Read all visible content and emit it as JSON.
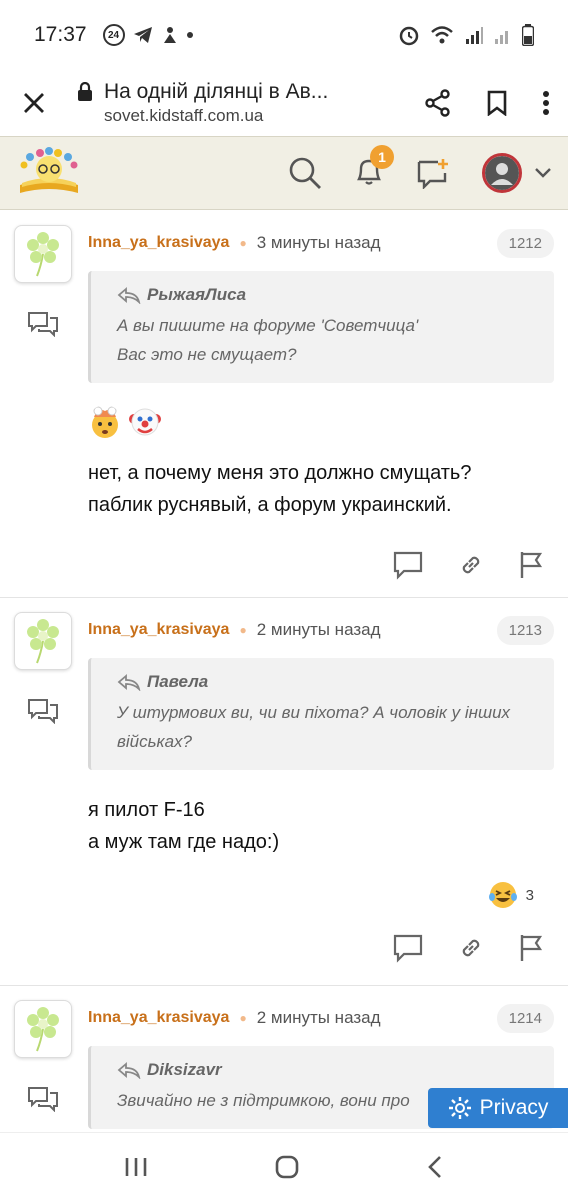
{
  "status_bar": {
    "time": "17:37",
    "badge": "24"
  },
  "browser": {
    "title": "На одній ділянці в Ав...",
    "url": "sovet.kidstaff.com.ua"
  },
  "header": {
    "notification_count": "1"
  },
  "posts": [
    {
      "user": "Inna_ya_krasivaya",
      "time": "3 минуты назад",
      "number": "1212",
      "quote_author": "РыжаяЛиса",
      "quote_lines": [
        "А вы пишите на форуме 'Советчица'",
        "Вас это не смущает?"
      ],
      "text_lines": [
        "нет, а почему меня это должно смущать?",
        "паблик руснявый, а форум украинский."
      ]
    },
    {
      "user": "Inna_ya_krasivaya",
      "time": "2 минуты назад",
      "number": "1213",
      "quote_author": "Павела",
      "quote_lines": [
        "У штурмових ви, чи ви піхота? А чоловік у інших",
        "військах?"
      ],
      "text_lines": [
        "я пилот F-16",
        "а муж там где надо:)"
      ],
      "reaction_count": "3"
    },
    {
      "user": "Inna_ya_krasivaya",
      "time": "2 минуты назад",
      "number": "1214",
      "quote_author": "Diksizavr",
      "quote_lines": [
        "Звичайно не з підтримкою, вони про"
      ]
    }
  ],
  "privacy": {
    "label": "Privacy"
  },
  "colors": {
    "username": "#c8701a",
    "privacy_bg": "#2f7fd0",
    "header_bg": "#f1efe4",
    "notification_badge": "#f0a030"
  }
}
